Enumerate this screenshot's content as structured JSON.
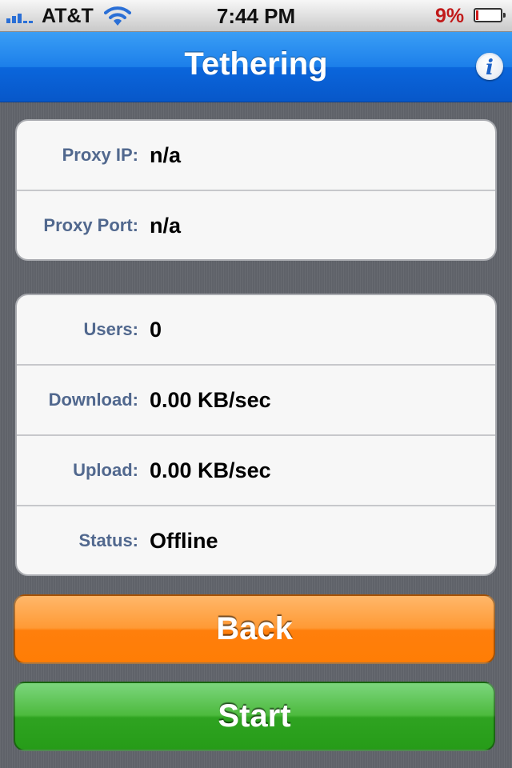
{
  "status_bar": {
    "carrier": "AT&T",
    "time": "7:44 PM",
    "battery_percent": "9%",
    "battery_level": 0.09,
    "icons": [
      "signal-icon",
      "wifi-icon",
      "battery-icon"
    ]
  },
  "nav": {
    "title": "Tethering",
    "info_glyph": "i"
  },
  "proxy": [
    {
      "label": "Proxy IP:",
      "value": "n/a"
    },
    {
      "label": "Proxy Port:",
      "value": "n/a"
    }
  ],
  "stats": [
    {
      "label": "Users:",
      "value": "0"
    },
    {
      "label": "Download:",
      "value": "0.00 KB/sec"
    },
    {
      "label": "Upload:",
      "value": "0.00 KB/sec"
    },
    {
      "label": "Status:",
      "value": "Offline"
    }
  ],
  "buttons": {
    "back": "Back",
    "start": "Start"
  },
  "colors": {
    "nav_blue": "#1c7fea",
    "label_blue": "#51688e",
    "back_orange": "#ff8a1f",
    "start_green": "#36a82a",
    "battery_red": "#c11a1a"
  }
}
